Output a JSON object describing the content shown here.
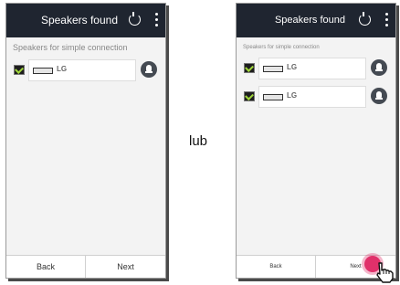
{
  "left_screen": {
    "header": {
      "title": "Speakers found"
    },
    "section_label": "Speakers for simple connection",
    "devices": [
      {
        "name": "LG"
      }
    ],
    "buttons": {
      "back": "Back",
      "next": "Next"
    }
  },
  "separator_text": "lub",
  "right_screen": {
    "header": {
      "title": "Speakers found"
    },
    "section_label": "Speakers for simple connection",
    "devices": [
      {
        "name": "LG"
      },
      {
        "name": "LG"
      }
    ],
    "buttons": {
      "back": "Back",
      "next": "Next"
    }
  },
  "colors": {
    "header_bg": "#1f2530",
    "check": "#9fd63a",
    "tap": "#e0306a"
  }
}
